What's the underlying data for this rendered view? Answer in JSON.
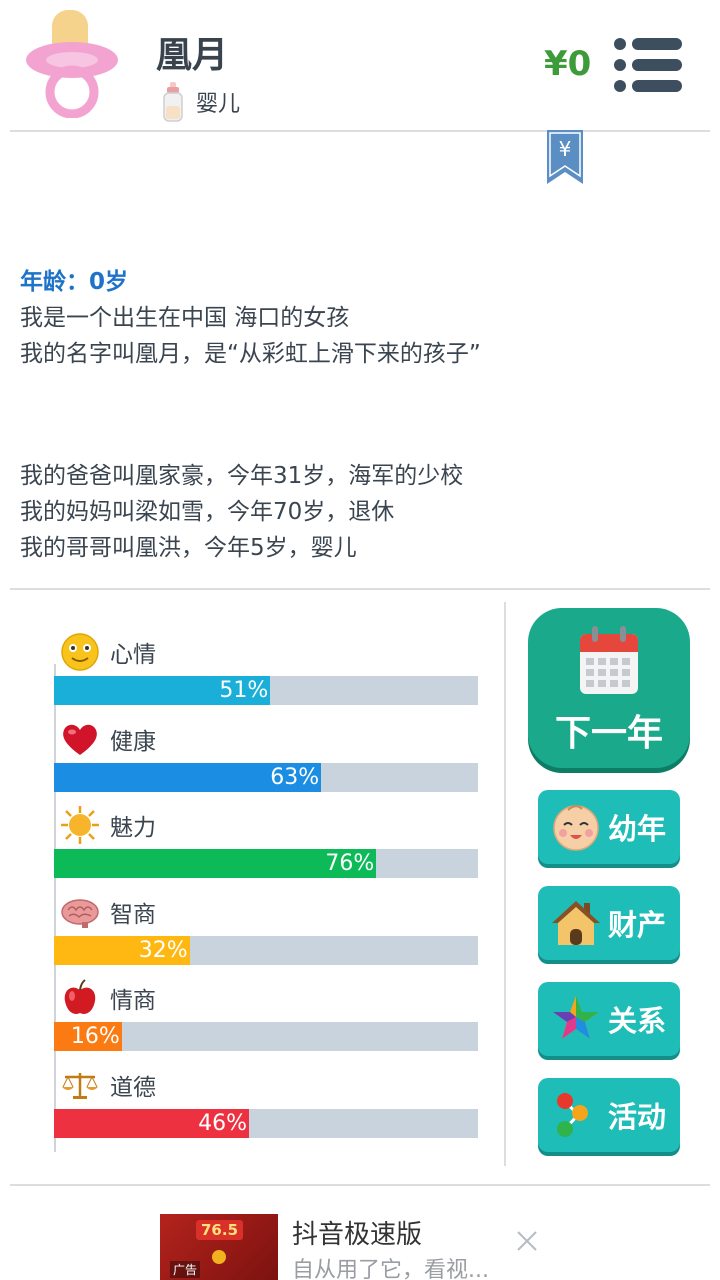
{
  "header": {
    "name": "凰月",
    "stage": "婴儿",
    "money": "¥0",
    "avatar_icon": "pacifier-icon",
    "stage_icon": "baby-bottle-icon",
    "menu_icon": "menu-icon"
  },
  "bookmark": {
    "symbol": "¥"
  },
  "bio": {
    "age": "年龄：0岁",
    "lines_top": [
      "我是一个出生在中国 海口的女孩",
      "我的名字叫凰月，是“从彩虹上滑下来的孩子”"
    ],
    "lines_family": [
      "我的爸爸叫凰家豪，今年31岁，海军的少校",
      "我的妈妈叫梁如雪，今年70岁，退休",
      "我的哥哥叫凰洪，今年5岁，婴儿"
    ]
  },
  "stats": [
    {
      "key": "mood",
      "label": "心情",
      "value": 51,
      "text": "51%",
      "color": "#19afd8",
      "icon": "smiley-icon"
    },
    {
      "key": "health",
      "label": "健康",
      "value": 63,
      "text": "63%",
      "color": "#1b8de3",
      "icon": "heart-icon"
    },
    {
      "key": "charm",
      "label": "魅力",
      "value": 76,
      "text": "76%",
      "color": "#0cbb58",
      "icon": "sun-icon"
    },
    {
      "key": "iq",
      "label": "智商",
      "value": 32,
      "text": "32%",
      "color": "#ffb812",
      "icon": "brain-icon"
    },
    {
      "key": "eq",
      "label": "情商",
      "value": 16,
      "text": "16%",
      "color": "#fb7a12",
      "icon": "apple-icon"
    },
    {
      "key": "morality",
      "label": "道德",
      "value": 46,
      "text": "46%",
      "color": "#ee3140",
      "icon": "scales-icon"
    }
  ],
  "actions": {
    "next_year": "下一年",
    "childhood": "幼年",
    "property": "财产",
    "relations": "关系",
    "activities": "活动"
  },
  "ad": {
    "title": "抖音极速版",
    "subtitle": "自从用了它，看视...",
    "badge": "广告",
    "image_number": "76.5"
  },
  "colors": {
    "accent_green": "#1aa98a",
    "button_teal": "#1ebdb8",
    "money_green": "#3d9b3a",
    "age_blue": "#1e73c9",
    "track_gray": "#c9d3de"
  }
}
